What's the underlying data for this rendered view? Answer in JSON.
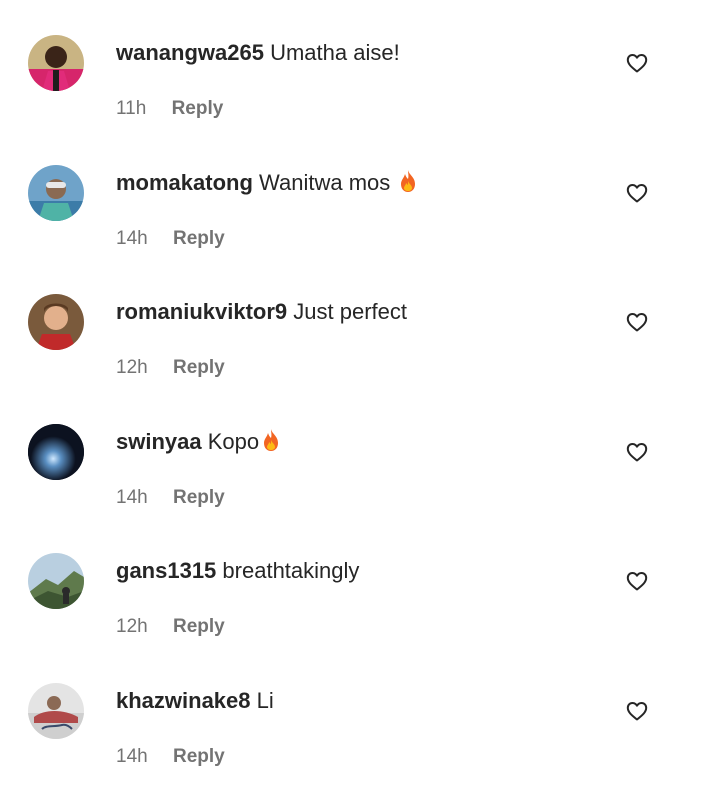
{
  "comments": [
    {
      "username": "wanangwa265",
      "text": "Umatha aise!",
      "emoji": "",
      "time": "11h",
      "reply_label": "Reply"
    },
    {
      "username": "momakatong",
      "text": "Wanitwa mos ",
      "emoji": "fire-icon",
      "time": "14h",
      "reply_label": "Reply"
    },
    {
      "username": "romaniukviktor9",
      "text": "Just perfect",
      "emoji": "",
      "time": "12h",
      "reply_label": "Reply"
    },
    {
      "username": "swinyaa",
      "text": "Kopo",
      "emoji": "fire-icon",
      "time": "14h",
      "reply_label": "Reply"
    },
    {
      "username": "gans1315",
      "text": "breathtakingly",
      "emoji": "",
      "time": "12h",
      "reply_label": "Reply"
    },
    {
      "username": "khazwinake8",
      "text": "Li",
      "emoji": "",
      "time": "14h",
      "reply_label": "Reply"
    }
  ],
  "icons": {
    "like": "heart-outline-icon",
    "emoji": "fire-icon"
  },
  "colors": {
    "text": "#262626",
    "meta": "#737373",
    "background": "#ffffff"
  }
}
